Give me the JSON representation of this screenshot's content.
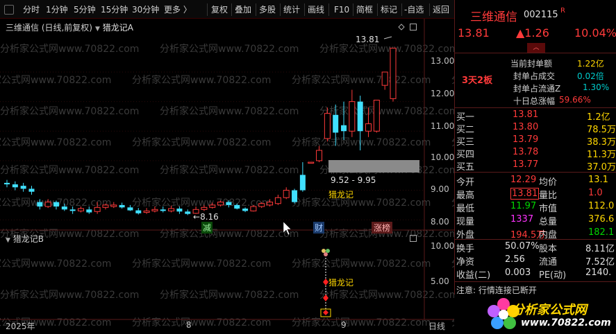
{
  "toolbar": {
    "periods": [
      "分时",
      "1分钟",
      "5分钟",
      "15分钟",
      "30分钟",
      "更多 〉"
    ],
    "actions": [
      "复权",
      "叠加",
      "多股",
      "统计",
      "画线",
      "F10",
      "简框",
      "标记",
      "-自选",
      "返回"
    ]
  },
  "main_chart": {
    "title": "三维通信 (日线,前复权)",
    "indicator": "猎龙记A",
    "high_label": "13.81",
    "low_label": "8.16",
    "range_label": "9.52 - 9.95",
    "signal_label": "猎龙记",
    "markers": {
      "jian": "减",
      "cai": "财",
      "zhangbang": "涨榜"
    },
    "y_ticks": [
      "13.00",
      "12.00",
      "11.00",
      "10.00",
      "9.00",
      "8.00"
    ]
  },
  "sub_chart": {
    "title": "猎龙记B",
    "signal_label": "猎龙记",
    "y_ticks": [
      "10.00",
      "5.00"
    ]
  },
  "x_axis": {
    "labels": [
      "2025年",
      "8",
      "9"
    ],
    "period": "日线"
  },
  "chart_data": {
    "type": "candlestick",
    "title": "三维通信 (日线,前复权)",
    "ylim": [
      7.7,
      14.5
    ],
    "candles": [
      {
        "o": 9.25,
        "c": 9.2,
        "h": 9.35,
        "l": 9.1
      },
      {
        "o": 9.2,
        "c": 9.1,
        "h": 9.3,
        "l": 9.0
      },
      {
        "o": 9.15,
        "c": 9.05,
        "h": 9.25,
        "l": 8.95
      },
      {
        "o": 9.05,
        "c": 8.95,
        "h": 9.15,
        "l": 8.85
      },
      {
        "o": 8.6,
        "c": 8.45,
        "h": 8.7,
        "l": 8.35
      },
      {
        "o": 8.45,
        "c": 8.6,
        "h": 8.7,
        "l": 8.4
      },
      {
        "o": 8.6,
        "c": 8.45,
        "h": 8.65,
        "l": 8.35
      },
      {
        "o": 8.45,
        "c": 8.35,
        "h": 8.55,
        "l": 8.3
      },
      {
        "o": 8.35,
        "c": 8.3,
        "h": 8.45,
        "l": 8.2
      },
      {
        "o": 8.3,
        "c": 8.38,
        "h": 8.45,
        "l": 8.25
      },
      {
        "o": 8.35,
        "c": 8.25,
        "h": 8.45,
        "l": 8.2
      },
      {
        "o": 8.28,
        "c": 8.42,
        "h": 8.6,
        "l": 8.2
      },
      {
        "o": 8.42,
        "c": 8.5,
        "h": 8.55,
        "l": 8.35
      },
      {
        "o": 8.45,
        "c": 8.5,
        "h": 8.6,
        "l": 8.4
      },
      {
        "o": 8.5,
        "c": 8.42,
        "h": 8.58,
        "l": 8.38
      },
      {
        "o": 8.42,
        "c": 8.32,
        "h": 8.5,
        "l": 8.3
      },
      {
        "o": 8.32,
        "c": 8.22,
        "h": 8.4,
        "l": 8.18
      },
      {
        "o": 8.25,
        "c": 8.3,
        "h": 8.4,
        "l": 8.2
      },
      {
        "o": 8.3,
        "c": 8.35,
        "h": 8.45,
        "l": 8.25
      },
      {
        "o": 8.35,
        "c": 8.3,
        "h": 8.45,
        "l": 8.25
      },
      {
        "o": 8.3,
        "c": 8.38,
        "h": 8.48,
        "l": 8.25
      },
      {
        "o": 8.38,
        "c": 8.28,
        "h": 8.45,
        "l": 8.2
      },
      {
        "o": 8.28,
        "c": 8.2,
        "h": 8.35,
        "l": 8.16
      },
      {
        "o": 8.22,
        "c": 8.35,
        "h": 8.45,
        "l": 8.2
      },
      {
        "o": 8.35,
        "c": 8.42,
        "h": 8.5,
        "l": 8.3
      },
      {
        "o": 8.42,
        "c": 8.5,
        "h": 8.58,
        "l": 8.38
      },
      {
        "o": 8.5,
        "c": 8.6,
        "h": 8.65,
        "l": 8.45
      },
      {
        "o": 8.6,
        "c": 8.5,
        "h": 8.66,
        "l": 8.42
      },
      {
        "o": 8.5,
        "c": 8.38,
        "h": 8.55,
        "l": 8.35
      },
      {
        "o": 8.38,
        "c": 8.3,
        "h": 8.42,
        "l": 8.26
      },
      {
        "o": 8.3,
        "c": 8.45,
        "h": 8.5,
        "l": 8.28
      },
      {
        "o": 8.45,
        "c": 8.55,
        "h": 8.6,
        "l": 8.4
      },
      {
        "o": 8.5,
        "c": 8.6,
        "h": 8.7,
        "l": 8.45
      },
      {
        "o": 8.55,
        "c": 8.75,
        "h": 8.85,
        "l": 8.5
      },
      {
        "o": 8.75,
        "c": 9.0,
        "h": 9.1,
        "l": 8.7
      },
      {
        "o": 9.0,
        "c": 8.6,
        "h": 9.05,
        "l": 8.55
      },
      {
        "o": 9.52,
        "c": 9.0,
        "h": 9.95,
        "l": 8.95
      },
      {
        "o": 9.95,
        "c": 9.95,
        "h": 9.95,
        "l": 9.95
      },
      {
        "o": 10.0,
        "c": 10.35,
        "h": 10.5,
        "l": 9.95
      },
      {
        "o": 10.75,
        "c": 11.6,
        "h": 11.8,
        "l": 10.65
      },
      {
        "o": 11.55,
        "c": 10.95,
        "h": 11.9,
        "l": 10.5
      },
      {
        "o": 11.2,
        "c": 11.0,
        "h": 12.0,
        "l": 10.7
      },
      {
        "o": 11.0,
        "c": 12.0,
        "h": 12.4,
        "l": 10.8
      },
      {
        "o": 12.0,
        "c": 11.0,
        "h": 12.2,
        "l": 10.35
      },
      {
        "o": 11.0,
        "c": 11.25,
        "h": 11.8,
        "l": 10.8
      },
      {
        "o": 11.0,
        "c": 12.05,
        "h": 12.05,
        "l": 10.95
      },
      {
        "o": 12.55,
        "c": 13.0,
        "h": 13.0,
        "l": 12.4
      },
      {
        "o": 12.1,
        "c": 13.81,
        "h": 13.81,
        "l": 12.0
      }
    ]
  },
  "panel": {
    "stock_name": "三维通信",
    "stock_code": "002115",
    "r_tag": "R",
    "price": "13.81",
    "change": "▲1.26",
    "pct": "10.04%",
    "board_tag": "3天2板",
    "stats": [
      {
        "label": "当前封单额",
        "value": "1.22亿"
      },
      {
        "label": "封单占成交",
        "value": "0.02倍"
      },
      {
        "label": "封单占流通Z",
        "value": "1.30%"
      },
      {
        "label": "十日总涨幅",
        "value": "59.66%"
      }
    ],
    "orders": [
      {
        "label": "买一",
        "price": "13.81",
        "vol": "1.2亿"
      },
      {
        "label": "买二",
        "price": "13.80",
        "vol": "78.5万"
      },
      {
        "label": "买三",
        "price": "13.79",
        "vol": "38.3万"
      },
      {
        "label": "买四",
        "price": "13.78",
        "vol": "11.3万"
      },
      {
        "label": "买五",
        "price": "13.77",
        "vol": "37.0万"
      }
    ],
    "quote_rows": [
      {
        "l1": "今开",
        "v1": "12.29",
        "l2": "均价",
        "v2": "13.1"
      },
      {
        "l1": "最高",
        "v1": "13.81",
        "l2": "量比",
        "v2": "1.0"
      },
      {
        "l1": "最低",
        "v1": "11.97",
        "l2": "市值",
        "v2": "112.0"
      },
      {
        "l1": "现量",
        "v1": "1337",
        "l2": "总量",
        "v2": "376.6"
      },
      {
        "l1": "外盘",
        "v1": "194.5万",
        "l2": "内盘",
        "v2": "182.1"
      }
    ],
    "fin_rows": [
      {
        "l1": "换手",
        "v1": "50.07%",
        "l2": "股本",
        "v2": "8.11亿"
      },
      {
        "l1": "净资",
        "v1": "2.56",
        "l2": "流通",
        "v2": "7.52亿"
      },
      {
        "l1": "收益(二)",
        "v1": "0.003",
        "l2": "PE(动)",
        "v2": "2140."
      }
    ],
    "notice": "注意: 行情连接已断开",
    "logo_text": "分析家公式网",
    "logo_url": "www.70822.com"
  },
  "watermark": "分析家公式网www.70822.com"
}
